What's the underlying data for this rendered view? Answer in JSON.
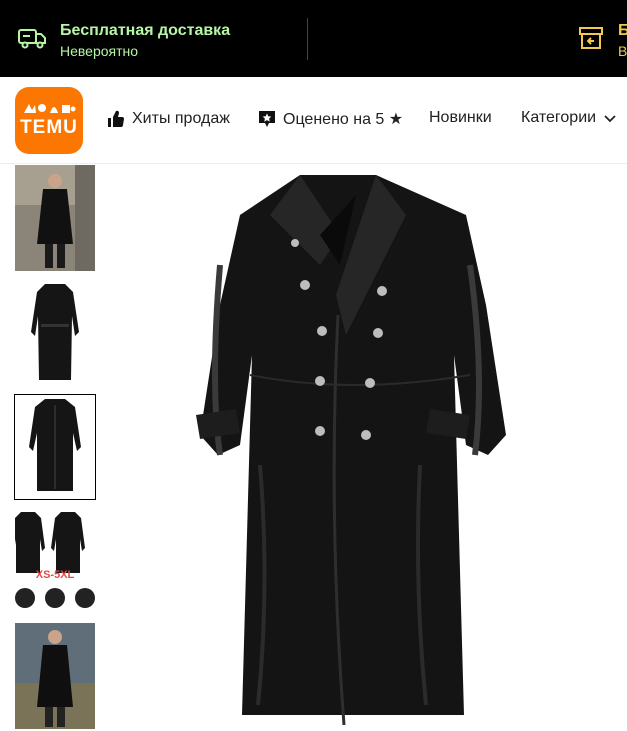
{
  "promo": {
    "free_shipping_title": "Бесплатная доставка",
    "free_shipping_sub": "Невероятно",
    "right_title_cut": "Б",
    "right_sub_cut": "В",
    "icons": [
      "truck-icon",
      "box-return-icon"
    ],
    "accent_color": "#b7f5a6"
  },
  "header": {
    "logo_text": "TEMU",
    "nav": {
      "hits": "Хиты продаж",
      "rated": "Оценено на 5 ★",
      "new": "Новинки",
      "categories": "Категории"
    },
    "brand_color": "#fb7701"
  },
  "gallery": {
    "thumbnails": [
      {
        "name": "coat-street-photo",
        "selected": false
      },
      {
        "name": "coat-back-view",
        "selected": false
      },
      {
        "name": "coat-front-view",
        "selected": true
      },
      {
        "name": "coat-size-collage",
        "caption": "XS-5XL",
        "selected": false
      },
      {
        "name": "coat-model-outdoor",
        "selected": false
      }
    ]
  }
}
